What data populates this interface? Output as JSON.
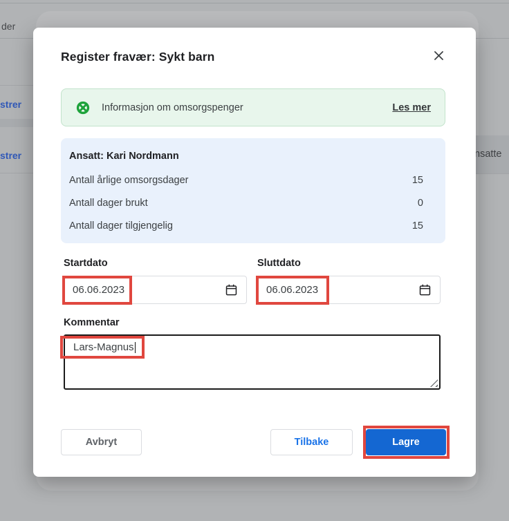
{
  "colors": {
    "accent_blue": "#1467d2",
    "link_blue": "#1a73e8",
    "annotation_red": "#e0473f",
    "icon_green": "#1fa33c",
    "banner_bg": "#e8f6ec",
    "banner_border": "#c2e3cb",
    "summary_bg": "#e9f1fc",
    "overlay_gray": "#b1b3b5"
  },
  "background": {
    "top_left_text": "der",
    "row_links": [
      {
        "label": "strer"
      },
      {
        "label": "strer"
      }
    ],
    "right_panel_text": "nsatte"
  },
  "dialog": {
    "title": "Register fravær: Sykt barn",
    "banner": {
      "icon": "lifebuoy-icon",
      "text": "Informasjon om omsorgspenger",
      "link_label": "Les mer"
    },
    "summary": {
      "header": "Ansatt: Kari Nordmann",
      "rows": [
        {
          "label": "Antall årlige omsorgsdager",
          "value": "15"
        },
        {
          "label": "Antall dager brukt",
          "value": "0"
        },
        {
          "label": "Antall dager tilgjengelig",
          "value": "15"
        }
      ]
    },
    "fields": {
      "start_date": {
        "label": "Startdato",
        "value": "06.06.2023"
      },
      "end_date": {
        "label": "Sluttdato",
        "value": "06.06.2023"
      },
      "comment": {
        "label": "Kommentar",
        "value": "Lars-Magnus"
      }
    },
    "buttons": {
      "cancel_label": "Avbryt",
      "back_label": "Tilbake",
      "save_label": "Lagre"
    }
  }
}
